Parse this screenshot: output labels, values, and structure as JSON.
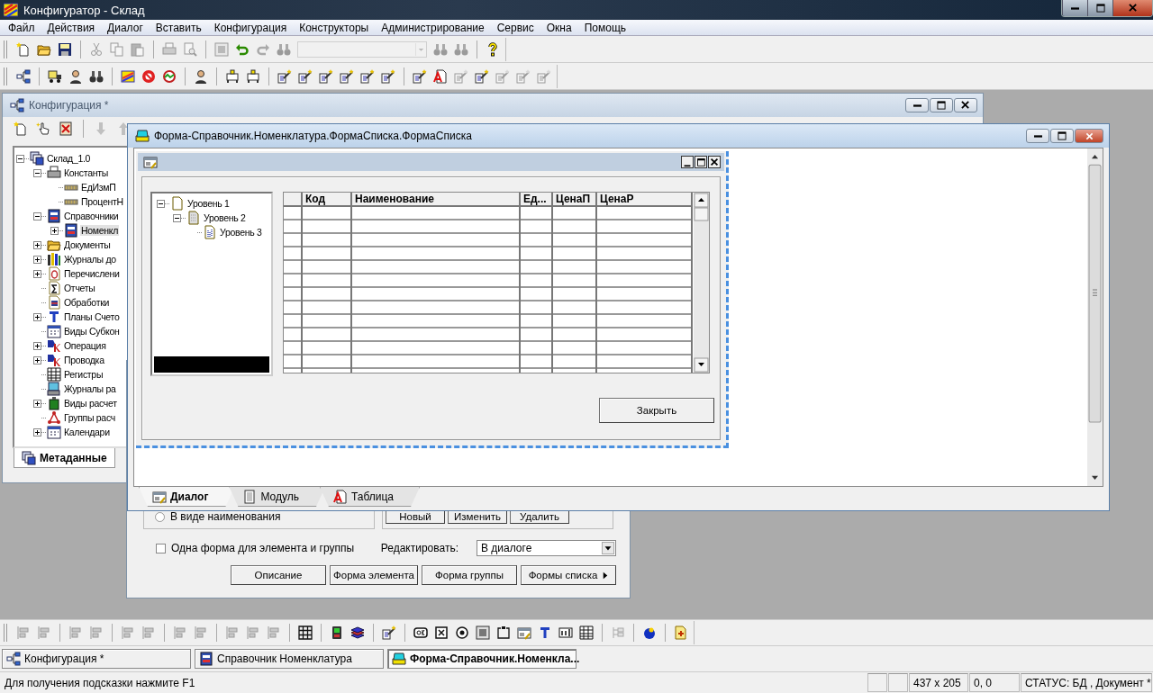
{
  "window": {
    "title": "Конфигуратор - Склад"
  },
  "menu": [
    "Файл",
    "Действия",
    "Диалог",
    "Вставить",
    "Конфигурация",
    "Конструкторы",
    "Администрирование",
    "Сервис",
    "Окна",
    "Помощь"
  ],
  "toolbars": [
    {
      "items": [
        {
          "kind": "button",
          "disabled": false
        },
        {
          "kind": "button",
          "disabled": false
        },
        {
          "kind": "button",
          "disabled": false
        },
        {
          "kind": "separator"
        },
        {
          "kind": "button",
          "disabled": true
        },
        {
          "kind": "button",
          "disabled": true
        },
        {
          "kind": "button",
          "disabled": true
        },
        {
          "kind": "separator"
        },
        {
          "kind": "button",
          "disabled": true
        },
        {
          "kind": "button",
          "disabled": true
        },
        {
          "kind": "separator"
        },
        {
          "kind": "button",
          "disabled": true
        },
        {
          "kind": "button",
          "disabled": false
        },
        {
          "kind": "button",
          "disabled": true
        },
        {
          "kind": "button",
          "disabled": true
        },
        {
          "kind": "combo",
          "disabled": true
        },
        {
          "kind": "button",
          "disabled": true
        },
        {
          "kind": "button",
          "disabled": true
        },
        {
          "kind": "separator"
        },
        {
          "kind": "button",
          "disabled": false
        }
      ]
    },
    {
      "items": [
        {
          "kind": "button",
          "disabled": false
        },
        {
          "kind": "separator"
        },
        {
          "kind": "button",
          "disabled": false
        },
        {
          "kind": "button",
          "disabled": false
        },
        {
          "kind": "button",
          "disabled": false
        },
        {
          "kind": "separator"
        },
        {
          "kind": "button",
          "disabled": false
        },
        {
          "kind": "button",
          "disabled": false
        },
        {
          "kind": "button",
          "disabled": false
        },
        {
          "kind": "separator"
        },
        {
          "kind": "button",
          "disabled": false
        },
        {
          "kind": "separator"
        },
        {
          "kind": "button",
          "disabled": false
        },
        {
          "kind": "button",
          "disabled": false
        },
        {
          "kind": "separator"
        },
        {
          "kind": "button",
          "disabled": false
        },
        {
          "kind": "button",
          "disabled": false
        },
        {
          "kind": "button",
          "disabled": false
        },
        {
          "kind": "button",
          "disabled": false
        },
        {
          "kind": "button",
          "disabled": false
        },
        {
          "kind": "button",
          "disabled": false
        },
        {
          "kind": "separator"
        },
        {
          "kind": "button",
          "disabled": false
        },
        {
          "kind": "button",
          "disabled": false
        },
        {
          "kind": "button",
          "disabled": true
        },
        {
          "kind": "button",
          "disabled": false
        },
        {
          "kind": "button",
          "disabled": true
        },
        {
          "kind": "button",
          "disabled": true
        },
        {
          "kind": "button",
          "disabled": true
        }
      ]
    }
  ],
  "config_window": {
    "title": "Конфигурация *",
    "toolbar": [
      {
        "disabled": false
      },
      {
        "disabled": false
      },
      {
        "disabled": false
      },
      {
        "disabled": true
      },
      {
        "disabled": true
      }
    ],
    "tree": [
      {
        "label": "Склад_1.0",
        "expanded": true,
        "selected": false,
        "children": [
          {
            "label": "Константы",
            "expanded": true,
            "selected": false,
            "children": [
              {
                "label": "ЕдИзмП",
                "selected": false
              },
              {
                "label": "ПроцентН",
                "selected": false
              }
            ]
          },
          {
            "label": "Справочники",
            "expanded": true,
            "selected": false,
            "children": [
              {
                "label": "Номенкл",
                "expanded": false,
                "selected": true
              }
            ]
          },
          {
            "label": "Документы",
            "expanded": false,
            "selected": false
          },
          {
            "label": "Журналы до",
            "expanded": false,
            "selected": false
          },
          {
            "label": "Перечислени",
            "expanded": false,
            "selected": false
          },
          {
            "label": "Отчеты",
            "selected": false
          },
          {
            "label": "Обработки",
            "selected": false
          },
          {
            "label": "Планы Счето",
            "expanded": false,
            "selected": false
          },
          {
            "label": "Виды Субкон",
            "selected": false
          },
          {
            "label": "Операция",
            "expanded": false,
            "selected": false
          },
          {
            "label": "Проводка",
            "expanded": false,
            "selected": false
          },
          {
            "label": "Регистры",
            "selected": false
          },
          {
            "label": "Журналы ра",
            "selected": false
          },
          {
            "label": "Виды расчет",
            "expanded": false,
            "selected": false
          },
          {
            "label": "Группы расч",
            "selected": false
          },
          {
            "label": "Календари",
            "expanded": false,
            "selected": false
          }
        ]
      }
    ],
    "tabs": [
      {
        "label": "Метаданные",
        "selected": true
      }
    ]
  },
  "catalog_window": {
    "radio": {
      "label": "В виде наименования",
      "selected": false
    },
    "group_buttons": [
      "Новый",
      "Изменить",
      "Удалить"
    ],
    "checkbox": {
      "label": "Одна форма для элемента и группы",
      "checked": false
    },
    "edit_label": "Редактировать:",
    "edit_select": {
      "value": "В диалоге"
    },
    "buttons": [
      {
        "label": "Описание",
        "kind": "button"
      },
      {
        "label": "Форма элемента",
        "kind": "button"
      },
      {
        "label": "Форма группы",
        "kind": "button"
      },
      {
        "label": "Формы списка",
        "kind": "menu"
      }
    ]
  },
  "form_window": {
    "title": "Форма-Справочник.Номенклатура.ФормаСписка.ФормаСписка",
    "dialog": {
      "tree": [
        {
          "label": "Уровень 1",
          "expanded": true,
          "children": [
            {
              "label": "Уровень 2",
              "expanded": true,
              "children": [
                {
                  "label": "Уровень 3"
                }
              ]
            }
          ]
        }
      ],
      "table": {
        "columns": [
          "Код",
          "Наименование",
          "Ед...",
          "ЦенаП",
          "ЦенаР"
        ]
      },
      "close_button": "Закрыть"
    },
    "tabs": [
      {
        "label": "Диалог",
        "selected": true
      },
      {
        "label": "Модуль",
        "selected": false
      },
      {
        "label": "Таблица",
        "selected": false
      }
    ]
  },
  "bottom_toolbar": [
    {
      "kind": "button",
      "disabled": true
    },
    {
      "kind": "button",
      "disabled": true
    },
    {
      "kind": "separator"
    },
    {
      "kind": "button",
      "disabled": true
    },
    {
      "kind": "button",
      "disabled": true
    },
    {
      "kind": "separator"
    },
    {
      "kind": "button",
      "disabled": true
    },
    {
      "kind": "button",
      "disabled": true
    },
    {
      "kind": "separator"
    },
    {
      "kind": "button",
      "disabled": true
    },
    {
      "kind": "button",
      "disabled": true
    },
    {
      "kind": "separator"
    },
    {
      "kind": "button",
      "disabled": true
    },
    {
      "kind": "button",
      "disabled": true
    },
    {
      "kind": "button",
      "disabled": true
    },
    {
      "kind": "separator"
    },
    {
      "kind": "button",
      "disabled": false
    },
    {
      "kind": "separator"
    },
    {
      "kind": "button",
      "disabled": false
    },
    {
      "kind": "button",
      "disabled": false
    },
    {
      "kind": "separator"
    },
    {
      "kind": "button",
      "disabled": false
    },
    {
      "kind": "separator"
    },
    {
      "kind": "button",
      "disabled": false
    },
    {
      "kind": "button",
      "disabled": false
    },
    {
      "kind": "button",
      "disabled": false
    },
    {
      "kind": "button",
      "disabled": false
    },
    {
      "kind": "button",
      "disabled": false
    },
    {
      "kind": "button",
      "disabled": false
    },
    {
      "kind": "button",
      "disabled": false
    },
    {
      "kind": "button",
      "disabled": false
    },
    {
      "kind": "button",
      "disabled": false
    },
    {
      "kind": "separator"
    },
    {
      "kind": "button",
      "disabled": true
    },
    {
      "kind": "separator"
    },
    {
      "kind": "button",
      "disabled": false
    },
    {
      "kind": "separator"
    },
    {
      "kind": "button",
      "disabled": false
    }
  ],
  "taskbar": [
    {
      "label": "Конфигурация *",
      "selected": false
    },
    {
      "label": "Справочник Номенклатура",
      "selected": false
    },
    {
      "label": "Форма-Справочник.Номенкла...",
      "selected": true
    }
  ],
  "status_bar": {
    "hint": "Для получения подсказки нажмите F1",
    "size": "437 x 205",
    "position": "0, 0",
    "status": "СТАТУС: БД , Документ *"
  }
}
